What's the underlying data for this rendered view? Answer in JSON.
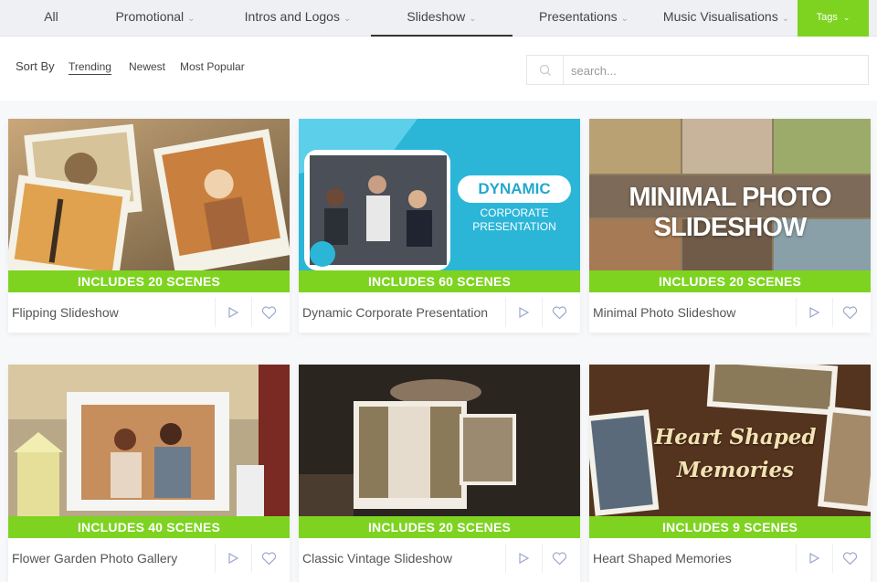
{
  "nav": {
    "items": [
      {
        "label": "All"
      },
      {
        "label": "Promotional"
      },
      {
        "label": "Intros and Logos"
      },
      {
        "label": "Slideshow"
      },
      {
        "label": "Presentations"
      },
      {
        "label": "Music Visualisations"
      }
    ],
    "active": "Slideshow",
    "tags_label": "Tags"
  },
  "sort": {
    "label": "Sort By",
    "options": [
      "Trending",
      "Newest",
      "Most Popular"
    ],
    "active": "Trending"
  },
  "search": {
    "placeholder": "search..."
  },
  "colors": {
    "accent": "#7ed321",
    "text": "#555555",
    "icon": "#9aa6cc"
  },
  "cards": [
    {
      "title": "Flipping Slideshow",
      "scenes": "INCLUDES 20 SCENES"
    },
    {
      "title": "Dynamic Corporate Presentation",
      "scenes": "INCLUDES 60 SCENES",
      "overlay": {
        "line1": "DYNAMIC",
        "line2": "CORPORATE",
        "line3": "PRESENTATION"
      }
    },
    {
      "title": "Minimal Photo Slideshow",
      "scenes": "INCLUDES 20 SCENES",
      "overlay": {
        "line1": "MINIMAL PHOTO SLIDESHOW"
      }
    },
    {
      "title": "Flower Garden Photo Gallery",
      "scenes": "INCLUDES 40 SCENES"
    },
    {
      "title": "Classic Vintage Slideshow",
      "scenes": "INCLUDES 20 SCENES"
    },
    {
      "title": "Heart Shaped Memories",
      "scenes": "INCLUDES 9 SCENES",
      "overlay": {
        "line1": "Heart Shaped",
        "line2": "Memories"
      }
    }
  ]
}
